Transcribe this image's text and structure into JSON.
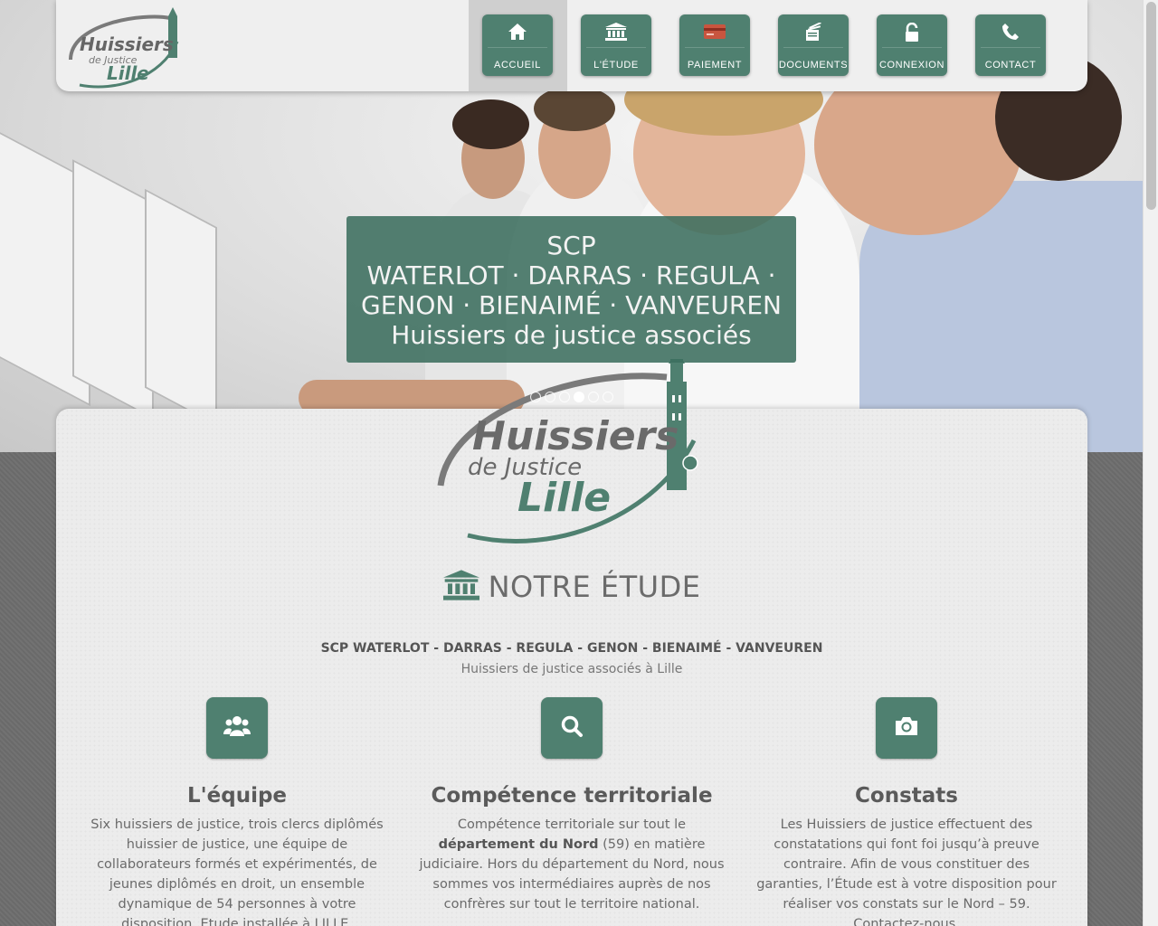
{
  "brand": {
    "logo_line1": "Huissiers",
    "logo_line2": "de Justice",
    "logo_line3": "Lille",
    "accent_color": "#4f8070"
  },
  "nav": {
    "items": [
      {
        "label": "ACCUEIL",
        "icon": "home-icon",
        "active": true
      },
      {
        "label": "L'ÉTUDE",
        "icon": "bank-icon",
        "active": false
      },
      {
        "label": "PAIEMENT",
        "icon": "credit-card-icon",
        "active": false
      },
      {
        "label": "DOCUMENTS",
        "icon": "documents-icon",
        "active": false
      },
      {
        "label": "CONNEXION",
        "icon": "unlock-icon",
        "active": false
      },
      {
        "label": "CONTACT",
        "icon": "phone-icon",
        "active": false
      }
    ]
  },
  "hero": {
    "caption_line1": "SCP",
    "caption_line2": "WATERLOT · DARRAS · REGULA ·",
    "caption_line3": "GENON · BIENAIMÉ · VANVEUREN",
    "caption_line4": "Huissiers de justice associés",
    "slide_count": 6,
    "active_slide": 4
  },
  "main": {
    "section_title": "NOTRE ÉTUDE",
    "firm_name": "SCP WATERLOT - DARRAS - REGULA - GENON - BIENAIMÉ - VANVEUREN",
    "firm_subtitle": "Huissiers de justice associés à Lille",
    "features": [
      {
        "icon": "users-icon",
        "title": "L'équipe",
        "text": "Six huissiers de justice, trois clercs diplômés huissier de justice, une équipe de collaborateurs formés et expérimentés, de jeunes diplômés en droit, un ensemble dynamique de 54 personnes à votre disposition. Etude installée à LILLE."
      },
      {
        "icon": "search-icon",
        "title": "Compétence territoriale",
        "text_before": "Compétence territoriale sur tout le ",
        "text_bold": "département du Nord",
        "text_after": " (59) en matière judiciaire. Hors du département du Nord, nous sommes vos intermédiaires auprès de nos confrères sur tout le territoire national."
      },
      {
        "icon": "camera-icon",
        "title": "Constats",
        "text": "Les Huissiers de justice effectuent des constatations qui font foi jusqu’à preuve contraire. Afin de vous constituer des garanties, l’Étude est à votre disposition pour réaliser vos constats sur le Nord – 59. Contactez-nous."
      }
    ]
  }
}
